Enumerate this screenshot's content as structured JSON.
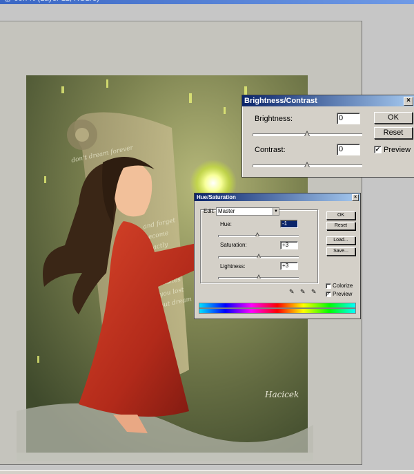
{
  "brightness_contrast": {
    "title": "Brightness/Contrast",
    "brightness_label": "Brightness:",
    "brightness_value": "0",
    "brightness_level": 0.5,
    "contrast_label": "Contrast:",
    "contrast_value": "0",
    "contrast_level": 0.5,
    "ok_label": "OK",
    "reset_label": "Reset",
    "preview_label": "Preview",
    "preview_checked": true
  },
  "hue_saturation": {
    "title": "Hue/Saturation",
    "edit_label": "Edit:",
    "edit_value": "Master",
    "hue_label": "Hue:",
    "hue_value": "-1",
    "hue_level": 0.5,
    "saturation_label": "Saturation:",
    "saturation_value": "+3",
    "saturation_level": 0.52,
    "lightness_label": "Lightness:",
    "lightness_value": "+3",
    "lightness_level": 0.52,
    "ok_label": "OK",
    "reset_label": "Reset",
    "load_label": "Load...",
    "save_label": "Save...",
    "colorize_label": "Colorize",
    "colorize_checked": false,
    "preview_label": "Preview",
    "preview_checked": true
  },
  "artwork": {
    "scroll_lines": [
      "don't dream forever",
      "and forget",
      "become",
      "exactly",
      "wishes",
      "you lost",
      "but dream",
      "..."
    ],
    "signature": "Hacicek"
  }
}
